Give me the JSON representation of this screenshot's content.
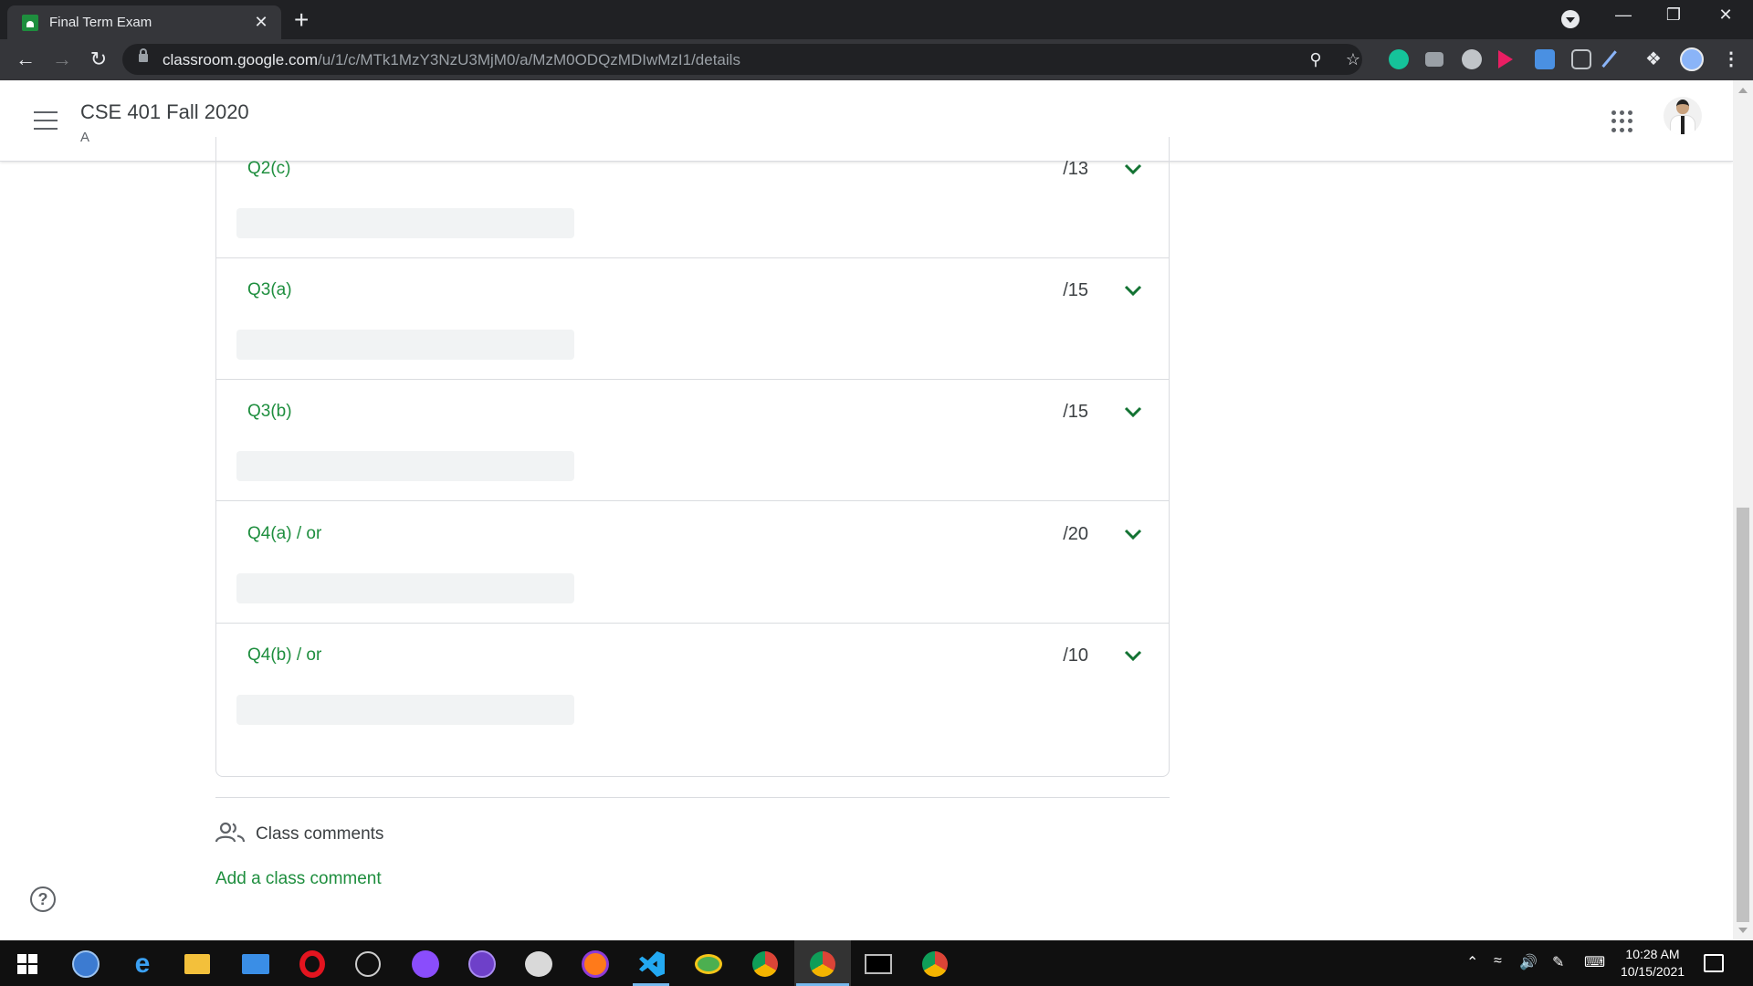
{
  "browser": {
    "tab_title": "Final Term Exam",
    "tab_close": "✕",
    "new_tab": "+",
    "url_host": "classroom.google.com",
    "url_path": "/u/1/c/MTk1MzY3NzU3MjM0/a/MzM0ODQzMDIwMzI1/details",
    "window_controls": [
      "—",
      "❐",
      "✕"
    ]
  },
  "header": {
    "class_name": "CSE 401 Fall 2020",
    "section": "A"
  },
  "rubric": {
    "criteria": [
      {
        "title": "Q2(c)",
        "points": "/13"
      },
      {
        "title": "Q3(a)",
        "points": "/15"
      },
      {
        "title": "Q3(b)",
        "points": "/15"
      },
      {
        "title": "Q4(a) / or",
        "points": "/20"
      },
      {
        "title": "Q4(b) / or",
        "points": "/10"
      }
    ]
  },
  "comments": {
    "heading": "Class comments",
    "add_label": "Add a class comment"
  },
  "help": {
    "label": "?"
  },
  "taskbar": {
    "apps": [
      "start",
      "qbittorrent",
      "edge",
      "file-explorer",
      "mail",
      "opera",
      "satellite",
      "messenger",
      "github-desktop",
      "paint",
      "firefox",
      "vscode",
      "sync",
      "chrome",
      "chrome",
      "terminal",
      "chrome"
    ],
    "time": "10:28 AM",
    "date": "10/15/2021"
  },
  "colors": {
    "accent_green": "#1e8e3e",
    "chrome_dark": "#202124",
    "chrome_toolbar": "#35363a"
  }
}
